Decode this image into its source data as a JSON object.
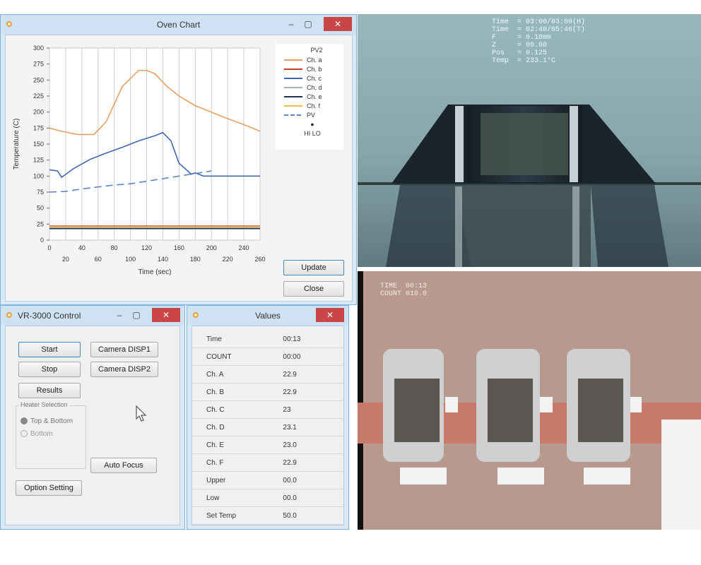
{
  "chart_window": {
    "title": "Oven Chart",
    "buttons": {
      "minimize": "–",
      "maximize": "▢",
      "close": "✕"
    },
    "start_button": "Update",
    "close_button": "Close"
  },
  "chart_data": {
    "type": "line",
    "title": "",
    "xlabel": "Time (sec)",
    "ylabel": "Temperature (C)",
    "ylim": [
      0,
      300
    ],
    "y_ticks": [
      "300",
      "275",
      "250",
      "225",
      "200",
      "175",
      "150",
      "125",
      "100",
      "75",
      "50",
      "25",
      "0"
    ],
    "x_ticks": [
      "0",
      "20",
      "40",
      "60",
      "80",
      "100",
      "120",
      "140",
      "160",
      "180",
      "200",
      "220",
      "240",
      "260"
    ],
    "x_tick_labels_row1": [
      "0",
      "40",
      "80",
      "120",
      "160",
      "200",
      "240"
    ],
    "x_tick_labels_row2": [
      "20",
      "60",
      "100",
      "140",
      "180",
      "220",
      "260"
    ],
    "grid": true,
    "legend_position": "right",
    "legend_header": "PV2",
    "series": [
      {
        "name": "Ch. a",
        "color": "#e8a060",
        "style": "solid",
        "x": [
          0,
          15,
          35,
          55,
          70,
          90,
          110,
          120,
          130,
          145,
          160,
          180,
          200,
          215,
          230,
          245,
          260
        ],
        "y": [
          175,
          170,
          165,
          165,
          185,
          240,
          265,
          265,
          260,
          240,
          225,
          210,
          200,
          192,
          185,
          178,
          170
        ]
      },
      {
        "name": "Ch. b",
        "color": "#c8442a",
        "style": "solid",
        "x": [
          0,
          20,
          40,
          60,
          80,
          100,
          120,
          140,
          160,
          180,
          200,
          220,
          240,
          260
        ],
        "y": [
          22,
          22,
          22,
          22,
          22,
          22,
          22,
          22,
          22,
          22,
          22,
          22,
          22,
          22
        ]
      },
      {
        "name": "Ch. c",
        "color": "#3e67b0",
        "style": "solid",
        "x": [
          0,
          10,
          15,
          30,
          50,
          70,
          90,
          110,
          130,
          140,
          150,
          160,
          175,
          180,
          190,
          210,
          230,
          250,
          260
        ],
        "y": [
          110,
          108,
          98,
          112,
          126,
          136,
          145,
          155,
          163,
          168,
          155,
          120,
          103,
          105,
          100,
          100,
          100,
          100,
          100
        ]
      },
      {
        "name": "Ch. d",
        "color": "#a8b0b8",
        "style": "solid",
        "x": [
          0,
          20,
          40,
          60,
          80,
          100,
          120,
          140,
          160,
          180,
          200,
          220,
          240,
          260
        ],
        "y": [
          20,
          20,
          20,
          20,
          20,
          20,
          20,
          20,
          20,
          20,
          20,
          20,
          20,
          20
        ]
      },
      {
        "name": "Ch. e",
        "color": "#1e3358",
        "style": "solid",
        "x": [
          0,
          20,
          40,
          60,
          80,
          100,
          120,
          140,
          160,
          180,
          200,
          220,
          240,
          260
        ],
        "y": [
          18,
          18,
          18,
          18,
          18,
          18,
          18,
          18,
          18,
          18,
          18,
          18,
          18,
          18
        ]
      },
      {
        "name": "Ch. f",
        "color": "#f0c040",
        "style": "solid",
        "x": [
          0,
          20,
          40,
          60,
          80,
          100,
          120,
          140,
          160,
          180,
          200,
          220,
          240,
          260
        ],
        "y": [
          21,
          21,
          21,
          21,
          21,
          21,
          21,
          21,
          21,
          21,
          21,
          21,
          21,
          21
        ]
      },
      {
        "name": "PV",
        "color": "#5f82c8",
        "style": "dashed",
        "x": [
          0,
          20,
          40,
          60,
          80,
          100,
          120,
          140,
          160,
          180,
          200
        ],
        "y": [
          75,
          76,
          80,
          83,
          86,
          88,
          92,
          96,
          100,
          104,
          108
        ]
      }
    ],
    "legend_extra": [
      "●",
      "HI LO"
    ]
  },
  "control_window": {
    "title": "VR-3000  Control",
    "buttons": {
      "minimize": "–",
      "maximize": "▢",
      "close": "✕"
    },
    "start": "Start",
    "stop": "Stop",
    "results": "Results",
    "camera1": "Camera DISP1",
    "camera2": "Camera DISP2",
    "group_label": "Heater Selection",
    "radio1": "Top & Bottom",
    "radio2": "Bottom",
    "auto_focus": "Auto Focus",
    "option_setting": "Option Setting"
  },
  "values_window": {
    "title": "Values",
    "close": "✕",
    "rows": [
      {
        "k": "Time",
        "v": "00:13"
      },
      {
        "k": "COUNT",
        "v": "00:00"
      },
      {
        "k": "Ch. A",
        "v": "22.9"
      },
      {
        "k": "Ch. B",
        "v": "22.9"
      },
      {
        "k": "Ch. C",
        "v": "23"
      },
      {
        "k": "Ch. D",
        "v": "23.1"
      },
      {
        "k": "Ch. E",
        "v": "23.0"
      },
      {
        "k": "Ch. F",
        "v": "22.9"
      },
      {
        "k": "Upper",
        "v": "00.0"
      },
      {
        "k": "Low",
        "v": "00.0"
      },
      {
        "k": "Set Temp",
        "v": "50.0"
      }
    ]
  },
  "camera_top": {
    "osd_lines": [
      "Time  = 03:00/03:00(H)",
      "Time  = 02:40/05:46(T)",
      "F     = 0.10mm",
      "Z     = 00.00",
      "Pos   = 0.125",
      "Temp  = 233.1°C"
    ]
  },
  "camera_bottom": {
    "osd_lines": [
      "TIME  00:13",
      "COUNT 010.0"
    ]
  }
}
